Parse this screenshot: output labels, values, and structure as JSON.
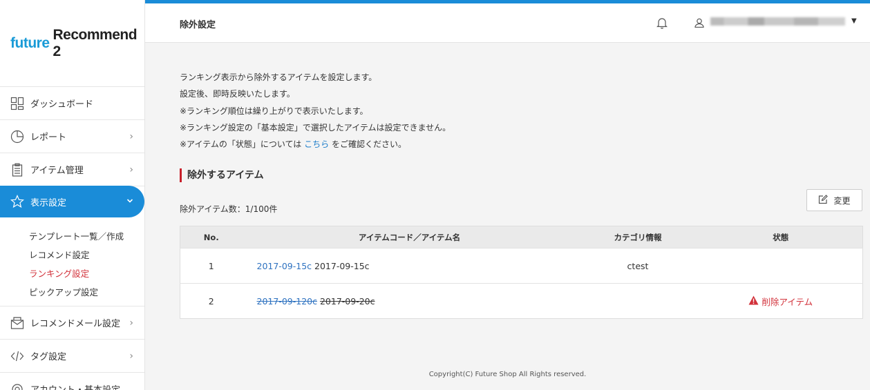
{
  "sidebar": {
    "logo_part1": "future",
    "logo_part2": "Recommend 2",
    "items": [
      {
        "label": "ダッシュボード"
      },
      {
        "label": "レポート"
      },
      {
        "label": "アイテム管理"
      },
      {
        "label": "表示設定"
      },
      {
        "label": "レコメンドメール設定"
      },
      {
        "label": "タグ設定"
      },
      {
        "label": "アカウント・基本設定"
      }
    ],
    "subitems": [
      {
        "label": "テンプレート一覧／作成"
      },
      {
        "label": "レコメンド設定"
      },
      {
        "label": "ランキング設定"
      },
      {
        "label": "ピックアップ設定"
      }
    ]
  },
  "header": {
    "title": "除外設定"
  },
  "description": {
    "lines": [
      "ランキング表示から除外するアイテムを設定します。",
      "設定後、即時反映いたします。",
      "※ランキング順位は繰り上がりで表示いたします。",
      "※ランキング設定の「基本設定」で選択したアイテムは設定できません。"
    ],
    "last_prefix": "※アイテムの「状態」については",
    "last_link": "こちら",
    "last_suffix": "をご確認ください。"
  },
  "section": {
    "title": "除外するアイテム",
    "count": "除外アイテム数：1/100件",
    "change_label": "変更"
  },
  "table": {
    "headers": {
      "no": "No.",
      "code": "アイテムコード／アイテム名",
      "category": "カテゴリ情報",
      "state": "状態"
    },
    "rows": [
      {
        "no": "1",
        "code": "2017-09-15c",
        "name": "2017-09-15c",
        "category": "ctest",
        "state": ""
      },
      {
        "no": "2",
        "code": "2017-09-120c",
        "name": "2017-09-20c",
        "category": "",
        "state": "削除アイテム"
      }
    ]
  },
  "footer": {
    "text": "Copyright(C) Future Shop All Rights reserved."
  },
  "colors": {
    "accent": "#1a8cd8",
    "danger": "#d2313a",
    "link": "#2e72c0"
  }
}
